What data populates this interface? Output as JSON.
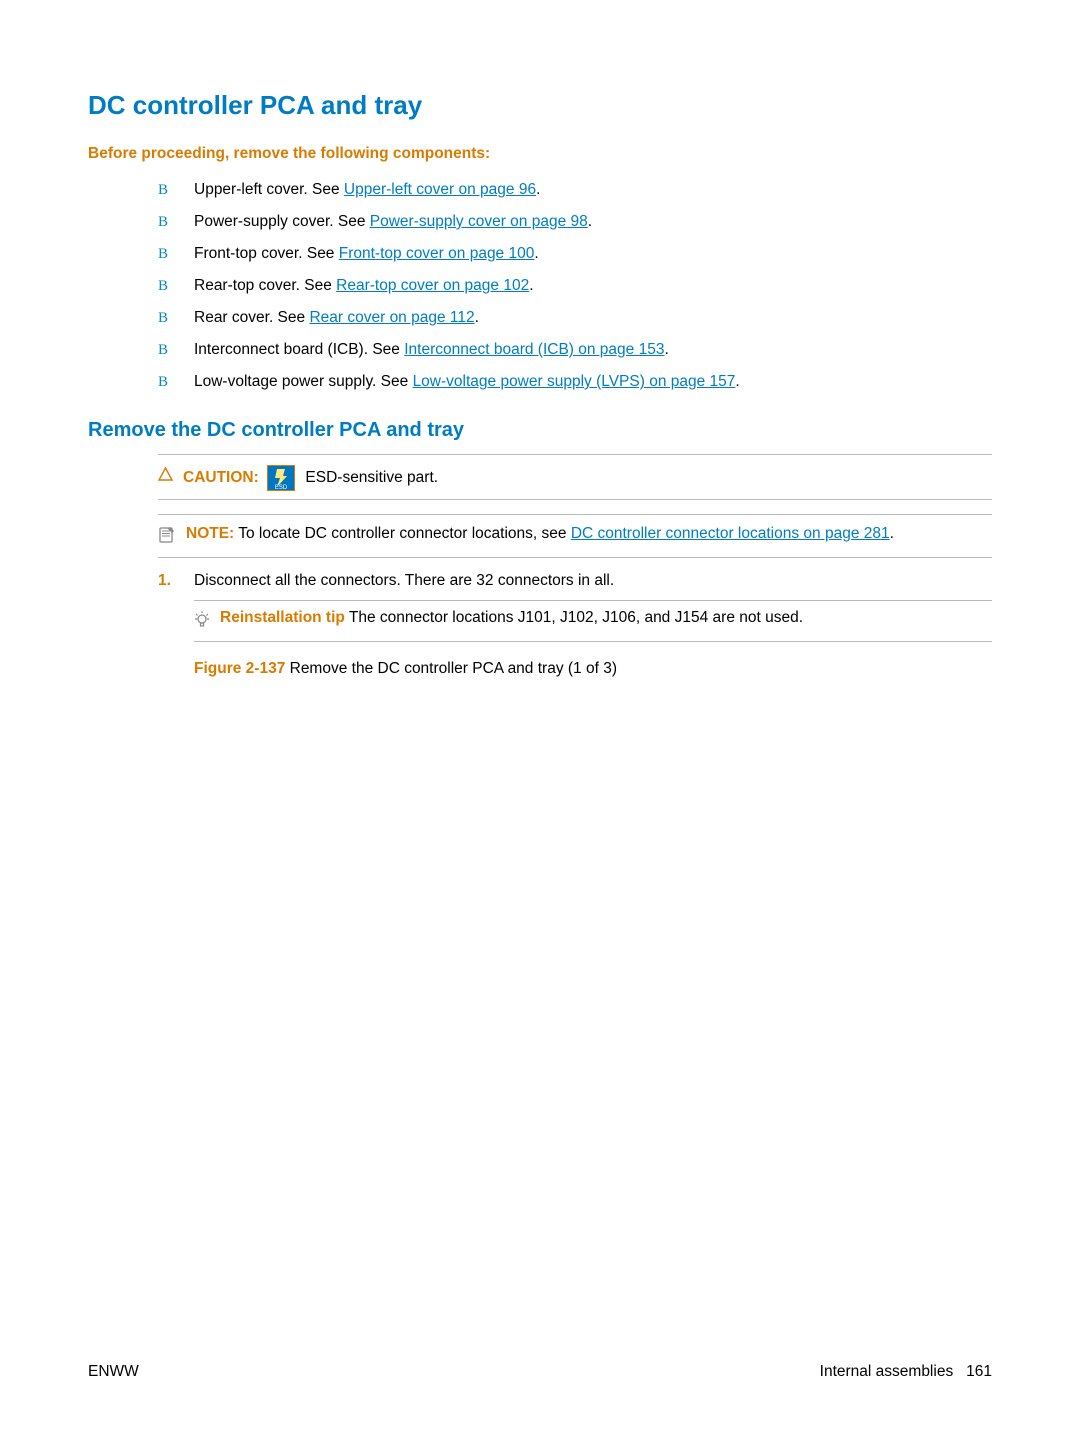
{
  "headings": {
    "h1": "DC controller PCA and tray",
    "h3_before": "Before proceeding, remove the following components:",
    "h2_remove": "Remove the DC controller PCA and tray"
  },
  "bullets": [
    {
      "pre": "Upper-left cover. See ",
      "link": "Upper-left cover on page 96",
      "post": "."
    },
    {
      "pre": "Power-supply cover. See ",
      "link": "Power-supply cover on page 98",
      "post": "."
    },
    {
      "pre": "Front-top cover. See ",
      "link": "Front-top cover on page 100",
      "post": "."
    },
    {
      "pre": "Rear-top cover. See ",
      "link": "Rear-top cover on page 102",
      "post": "."
    },
    {
      "pre": "Rear cover. See ",
      "link": "Rear cover on page 112",
      "post": "."
    },
    {
      "pre": "Interconnect board (ICB). See ",
      "link": "Interconnect board (ICB) on page 153",
      "post": "."
    },
    {
      "pre": "Low-voltage power supply. See ",
      "link": "Low-voltage power supply (LVPS) on page 157",
      "post": "."
    }
  ],
  "caution": {
    "label": "CAUTION:",
    "text": " ESD-sensitive part."
  },
  "note": {
    "label": "NOTE:",
    "pre": "   To locate DC controller connector locations, see ",
    "link": "DC controller connector locations on page 281",
    "post": "."
  },
  "step1": {
    "num": "1.",
    "text": "Disconnect all the connectors. There are 32 connectors in all."
  },
  "tip": {
    "label": "Reinstallation tip",
    "text": "   The connector locations J101, J102, J106, and J154 are not used."
  },
  "figure": {
    "label": "Figure 2-137",
    "text": "  Remove the DC controller PCA and tray (1 of 3)"
  },
  "footer": {
    "left": "ENWW",
    "right_text": "Internal assemblies",
    "right_page": "161"
  }
}
